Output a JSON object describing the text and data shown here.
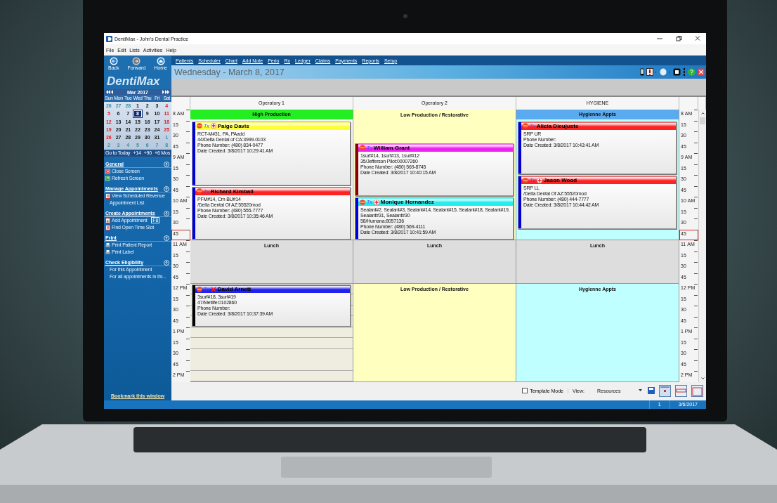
{
  "window": {
    "title": "DentiMax - John's Dental Practice"
  },
  "menu": [
    "File",
    "Edit",
    "Lists",
    "Activities",
    "Help"
  ],
  "nav": [
    {
      "label": "Back",
      "kind": "back"
    },
    {
      "label": "Forward",
      "kind": "forward"
    },
    {
      "label": "Home",
      "kind": "home"
    }
  ],
  "logo": "DentiMax",
  "modules": [
    "Patients",
    "Scheduler",
    "Chart",
    "Add Note",
    "Perio",
    "Rx",
    "Ledger",
    "Claims",
    "Payments",
    "Reports",
    "Setup"
  ],
  "date_title": "Wednesday - March 8, 2017",
  "calendar": {
    "month": "Mar 2017",
    "weekdays": [
      "Sun",
      "Mon",
      "Tue",
      "Wed",
      "Thu",
      "Fri",
      "Sat"
    ],
    "days": [
      {
        "day": "26",
        "muted": true,
        "selected": false
      },
      {
        "day": "27",
        "muted": true,
        "selected": false
      },
      {
        "day": "28",
        "muted": true,
        "selected": false
      },
      {
        "day": "1",
        "muted": false,
        "selected": false
      },
      {
        "day": "2",
        "muted": false,
        "selected": false
      },
      {
        "day": "3",
        "muted": false,
        "selected": false
      },
      {
        "day": "4",
        "muted": false,
        "selected": false
      },
      {
        "day": "5",
        "muted": false,
        "selected": false
      },
      {
        "day": "6",
        "muted": false,
        "selected": false
      },
      {
        "day": "7",
        "muted": false,
        "selected": false
      },
      {
        "day": "8",
        "muted": false,
        "selected": true
      },
      {
        "day": "9",
        "muted": false,
        "selected": false
      },
      {
        "day": "10",
        "muted": false,
        "selected": false
      },
      {
        "day": "11",
        "muted": false,
        "selected": false
      },
      {
        "day": "12",
        "muted": false,
        "selected": false
      },
      {
        "day": "13",
        "muted": false,
        "selected": false
      },
      {
        "day": "14",
        "muted": false,
        "selected": false
      },
      {
        "day": "15",
        "muted": false,
        "selected": false
      },
      {
        "day": "16",
        "muted": false,
        "selected": false
      },
      {
        "day": "17",
        "muted": false,
        "selected": false
      },
      {
        "day": "18",
        "muted": false,
        "selected": false
      },
      {
        "day": "19",
        "muted": false,
        "selected": false
      },
      {
        "day": "20",
        "muted": false,
        "selected": false
      },
      {
        "day": "21",
        "muted": false,
        "selected": false
      },
      {
        "day": "22",
        "muted": false,
        "selected": false
      },
      {
        "day": "23",
        "muted": false,
        "selected": false
      },
      {
        "day": "24",
        "muted": false,
        "selected": false
      },
      {
        "day": "25",
        "muted": false,
        "selected": false
      },
      {
        "day": "26",
        "muted": false,
        "selected": false
      },
      {
        "day": "27",
        "muted": false,
        "selected": false
      },
      {
        "day": "28",
        "muted": false,
        "selected": false
      },
      {
        "day": "29",
        "muted": false,
        "selected": false
      },
      {
        "day": "30",
        "muted": false,
        "selected": false
      },
      {
        "day": "31",
        "muted": false,
        "selected": false
      },
      {
        "day": "1",
        "muted": true,
        "selected": false
      },
      {
        "day": "2",
        "muted": true,
        "selected": false
      },
      {
        "day": "3",
        "muted": true,
        "selected": false
      },
      {
        "day": "4",
        "muted": true,
        "selected": false
      },
      {
        "day": "5",
        "muted": true,
        "selected": false
      },
      {
        "day": "6",
        "muted": true,
        "selected": false
      },
      {
        "day": "7",
        "muted": true,
        "selected": false
      },
      {
        "day": "8",
        "muted": true,
        "selected": false
      }
    ],
    "jumps": [
      "Go to Today",
      "+14",
      "+90",
      "+6 Mos"
    ]
  },
  "sidebar": {
    "sections": [
      {
        "title": "General",
        "items": [
          {
            "label": "Close Screen",
            "kind": "close"
          },
          {
            "label": "Refresh Screen",
            "kind": "refresh"
          }
        ]
      },
      {
        "title": "Manage Appointments",
        "items": [
          {
            "label": "View Scheduled Revenue",
            "kind": "report"
          },
          {
            "label": "Appointment List",
            "kind": "plain"
          }
        ]
      },
      {
        "title": "Create Appointments",
        "items": [
          {
            "label": "Add Appointment",
            "kind": "add",
            "shortcut": "F8"
          },
          {
            "label": "Find Open Time Slot",
            "kind": "report"
          }
        ]
      },
      {
        "title": "Print",
        "items": [
          {
            "label": "Print Patient Report",
            "kind": "print"
          },
          {
            "label": "Print Label",
            "kind": "print"
          }
        ]
      },
      {
        "title": "Check Eligibility",
        "items": [
          {
            "label": "For this Appointment",
            "kind": "plain"
          },
          {
            "label": "For all appointments in thi...",
            "kind": "plain"
          }
        ]
      }
    ],
    "bookmark": "Bookmark this window"
  },
  "times": [
    {
      "hour": "8",
      "suffix": "AM",
      "current": false
    },
    {
      "hour": "15",
      "current": false
    },
    {
      "hour": "30",
      "current": false
    },
    {
      "hour": "45",
      "current": false
    },
    {
      "hour": "9",
      "suffix": "AM",
      "current": false
    },
    {
      "hour": "15",
      "current": false
    },
    {
      "hour": "30",
      "current": false
    },
    {
      "hour": "45",
      "current": false
    },
    {
      "hour": "10",
      "suffix": "AM",
      "current": false
    },
    {
      "hour": "15",
      "current": false
    },
    {
      "hour": "30",
      "current": false
    },
    {
      "hour": "45",
      "current": true
    },
    {
      "hour": "11",
      "suffix": "AM",
      "current": false
    },
    {
      "hour": "15",
      "current": false
    },
    {
      "hour": "30",
      "current": false
    },
    {
      "hour": "45",
      "current": false
    },
    {
      "hour": "12",
      "suffix": "PM",
      "current": false
    },
    {
      "hour": "15",
      "current": false
    },
    {
      "hour": "30",
      "current": false
    },
    {
      "hour": "45",
      "current": false
    },
    {
      "hour": "1",
      "suffix": "PM",
      "current": false
    },
    {
      "hour": "15",
      "current": false
    },
    {
      "hour": "30",
      "current": false
    },
    {
      "hour": "45",
      "current": false
    },
    {
      "hour": "2",
      "suffix": "PM",
      "current": false
    }
  ],
  "times_right": [
    {
      "hour": "8",
      "suffix": "AM",
      "current": false
    },
    {
      "hour": "15",
      "current": false
    },
    {
      "hour": "30",
      "current": false
    },
    {
      "hour": "45",
      "current": false
    },
    {
      "hour": "9",
      "suffix": "AM",
      "current": false
    },
    {
      "hour": "15",
      "current": false
    },
    {
      "hour": "30",
      "current": false
    },
    {
      "hour": "45",
      "current": false
    },
    {
      "hour": "10",
      "suffix": "AM",
      "current": false
    },
    {
      "hour": "15",
      "current": false
    },
    {
      "hour": "30",
      "current": false
    },
    {
      "hour": "45",
      "current": true
    },
    {
      "hour": "11",
      "suffix": "AM",
      "current": false
    },
    {
      "hour": "15",
      "current": false
    },
    {
      "hour": "30",
      "current": false
    },
    {
      "hour": "45",
      "current": false
    },
    {
      "hour": "12",
      "suffix": "PM",
      "current": false
    },
    {
      "hour": "15",
      "current": false
    },
    {
      "hour": "30",
      "current": false
    },
    {
      "hour": "45",
      "current": false
    },
    {
      "hour": "1",
      "suffix": "PM",
      "current": false
    },
    {
      "hour": "15",
      "current": false
    },
    {
      "hour": "30",
      "current": false
    },
    {
      "hour": "45",
      "current": false
    },
    {
      "hour": "2",
      "suffix": "PM",
      "current": false
    }
  ],
  "columns": [
    {
      "title": "Operatory 1",
      "blocks": [
        {
          "kind": "template",
          "label": "High Production",
          "color": "#ffffff",
          "band": {
            "color": "#22ee22"
          }
        },
        {
          "kind": "lunch",
          "label": "Lunch",
          "color": "#dddddd"
        },
        {
          "kind": "open",
          "color": "#efece0"
        }
      ],
      "appointments": [
        {
          "patient": "Paige Davis",
          "tx": "Tx",
          "medical_alert": true,
          "x_mark": false,
          "color": "#ffff33",
          "status": {
            "color": "#0000dd"
          },
          "lines": [
            "RCT-M#31, PA, PAadd",
            "44/Delta Dental of CA:3999-0103",
            "Phone Number: (480) 834-0477",
            "Date Created: 3/8/2017 10:29:41 AM"
          ]
        },
        {
          "patient": "Richard Kimball",
          "tx": "Tx",
          "medical_alert": false,
          "x_mark": false,
          "color": "#ff2222",
          "status": {
            "color": "#0000dd"
          },
          "lines": [
            "PFM#14, Crn BU#14",
            "/Delta Dental Of AZ:55520mod",
            "Phone Number: (480) 555-7777",
            "Date Created: 3/8/2017 10:35:46 AM"
          ]
        },
        {
          "patient": "David Arnett",
          "tx": "Tx",
          "medical_alert": false,
          "x_mark": true,
          "color": "#2222ee",
          "status": {
            "color": "#000000"
          },
          "lines": [
            "3surf#18, 3surf#19",
            "47/Metlife:0102860",
            "Phone Number:",
            "Date Created: 3/8/2017 10:37:39 AM"
          ]
        }
      ]
    },
    {
      "title": "Operatory 2",
      "blocks": [
        {
          "kind": "template",
          "label": "Low Production / Restorative",
          "color": "#ffffc0"
        },
        {
          "kind": "lunch",
          "label": "Lunch",
          "color": "#dddddd"
        },
        {
          "kind": "template",
          "label": "Low Production / Restorative",
          "color": "#ffffc0"
        }
      ],
      "appointments": [
        {
          "patient": "William Grant",
          "tx": "Tx",
          "medical_alert": false,
          "x_mark": false,
          "color": "#ee22ee",
          "status": {
            "color": "#880000"
          },
          "lines": [
            "1surf#14, 1surf#13, 1surf#12",
            "35/Jefferson Pilot:00007260",
            "Phone Number: (480) 569-8745",
            "Date Created: 3/8/2017 10:40:15 AM"
          ]
        },
        {
          "patient": "Monique Hernandez",
          "tx": "Tx",
          "medical_alert": true,
          "x_mark": false,
          "color": "#22eeee",
          "status": {
            "color": "#0000dd"
          },
          "lines": [
            "Sealant#2, Sealant#3, Sealant#14, Sealant#15, Sealant#18, Sealant#19, Sealant#31, Sealant#30",
            "58/Humana:8057136",
            "Phone Number: (480) 569-4111",
            "Date Created: 3/8/2017 10:41:59 AM"
          ]
        }
      ]
    },
    {
      "title": "HYGIENE",
      "blocks": [
        {
          "kind": "template",
          "label": "Hygienne Appts",
          "color": "#c0ffff",
          "band": {
            "color": "#5aaaf0"
          }
        },
        {
          "kind": "lunch",
          "label": "Lunch",
          "color": "#dddddd"
        },
        {
          "kind": "template",
          "label": "Hygienne Appts",
          "color": "#c0ffff"
        }
      ],
      "appointments": [
        {
          "patient": "Alicia Dieujuste",
          "tx": "Tx",
          "medical_alert": false,
          "x_mark": false,
          "color": "#ff2222",
          "status": {
            "color": "#0000dd"
          },
          "lines": [
            "SRP UR",
            "Phone Number:",
            "Date Created: 3/8/2017 10:43:41 AM"
          ]
        },
        {
          "patient": "Jason Wood",
          "tx": "Tx",
          "medical_alert": true,
          "x_mark": false,
          "color": "#ff2222",
          "status": {
            "color": "#0000dd"
          },
          "lines": [
            "SRP LL",
            "/Delta Dental Of AZ:55520mod",
            "Phone Number: (480) 444-7777",
            "Date Created: 3/8/2017 10:44:42 AM"
          ]
        }
      ]
    }
  ],
  "bottom_bar": {
    "template_mode": {
      "label": "Template Mode",
      "checked": false
    },
    "view_label": "View:",
    "view_value": "Resources"
  },
  "status_bar": [
    "1",
    "3/6/2017"
  ]
}
